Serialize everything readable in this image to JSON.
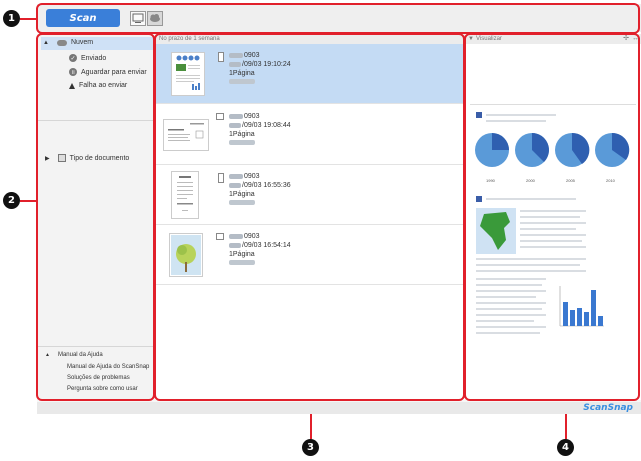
{
  "callouts": [
    "1",
    "2",
    "3",
    "4"
  ],
  "toolbar": {
    "scan_label": "Scan",
    "icons": [
      "computer-icon",
      "cloud-icon"
    ]
  },
  "sidebar": {
    "root": "Nuvem",
    "items": [
      "Enviado",
      "Aguardar para enviar",
      "Falha ao enviar"
    ],
    "doc_type": "Tipo de documento",
    "help": {
      "title": "Manual da Ajuda",
      "items": [
        "Manual de Ajuda do ScanSnap",
        "Soluções de problemas",
        "Pergunta sobre como usar"
      ]
    }
  },
  "list": {
    "header": "No prazo de 1 semana",
    "rows": [
      {
        "name_suffix": "0903",
        "datetime": "/09/03 19:10:24",
        "pages": "1Página",
        "selected": true
      },
      {
        "name_suffix": "0903",
        "datetime": "/09/03 19:08:44",
        "pages": "1Página",
        "selected": false
      },
      {
        "name_suffix": "0903",
        "datetime": "/09/03 16:55:36",
        "pages": "1Página",
        "selected": false
      },
      {
        "name_suffix": "0903",
        "datetime": "/09/03 16:54:14",
        "pages": "1Página",
        "selected": false
      }
    ]
  },
  "preview": {
    "header": "Visualizar",
    "year_labels": [
      "1990",
      "2000",
      "2005",
      "2010"
    ]
  },
  "statusbar": {
    "logo": "ScanSnap"
  },
  "colors": {
    "accent": "#3a7fd9",
    "callout_frame": "#e1202b",
    "selection": "#c4dbf4"
  }
}
